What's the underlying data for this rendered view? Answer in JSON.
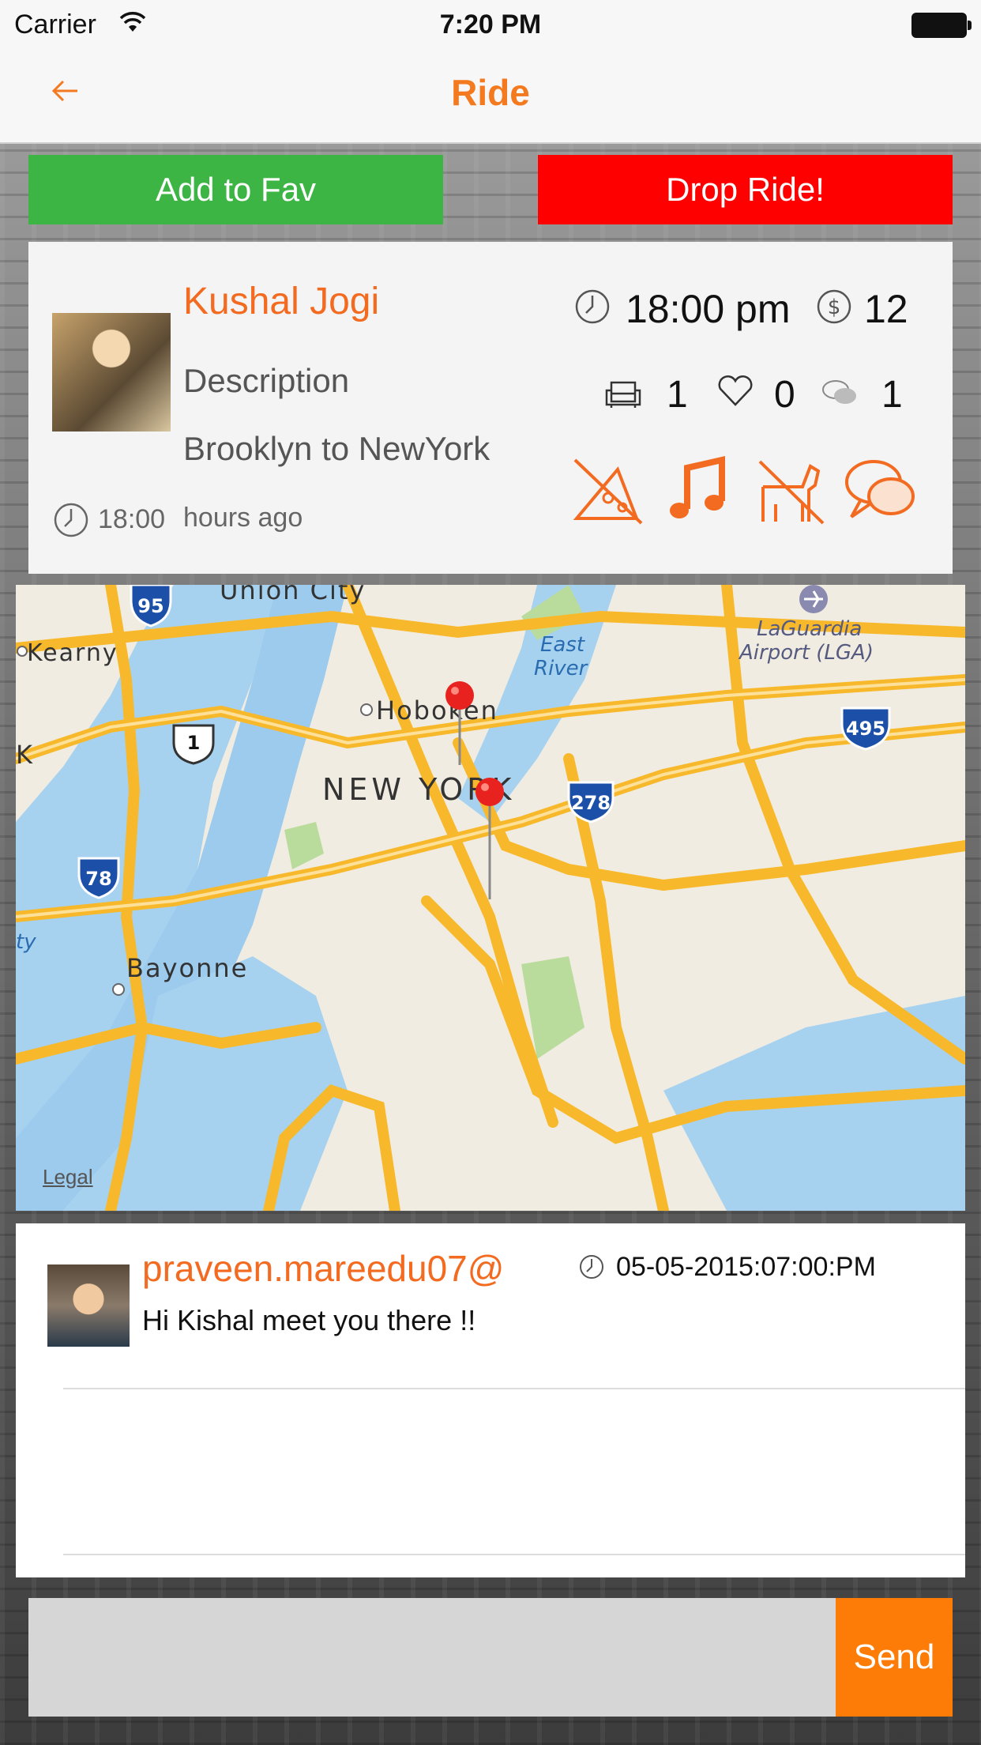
{
  "status_bar": {
    "carrier": "Carrier",
    "time": "7:20 PM"
  },
  "nav": {
    "title": "Ride"
  },
  "actions": {
    "fav_label": "Add to Fav",
    "drop_label": "Drop Ride!"
  },
  "ride": {
    "driver": "Kushal Jogi",
    "description": "Description",
    "route": "Brooklyn to NewYork",
    "posted_time": "18:00",
    "posted_suffix": "hours ago",
    "departure": "18:00 pm",
    "price": "12",
    "seats": "1",
    "likes": "0",
    "comments": "1",
    "preferences": [
      "no-food-icon",
      "music-icon",
      "no-pets-icon",
      "chat-icon"
    ]
  },
  "map": {
    "legal": "Legal",
    "labels": {
      "union_city": "Union City",
      "kearny": "Kearny",
      "hoboken": "Hoboken",
      "new_york": "NEW YORK",
      "bayonne": "Bayonne",
      "east_river_1": "East",
      "east_river_2": "River",
      "laguardia_1": "LaGuardia",
      "laguardia_2": "Airport (LGA)",
      "k": "K",
      "ty": "ty"
    },
    "shields": {
      "i95": "95",
      "us1": "1",
      "i495": "495",
      "i278": "278",
      "i78": "78"
    }
  },
  "comment": {
    "user": "praveen.mareedu07@",
    "date": "05-05-2015:07:00:PM",
    "text": "Hi Kishal meet you there !!"
  },
  "composer": {
    "placeholder": "",
    "send_label": "Send"
  },
  "colors": {
    "accent": "#f47a20",
    "fav": "#3db545",
    "drop": "#fe0000",
    "send": "#fd7b07"
  }
}
